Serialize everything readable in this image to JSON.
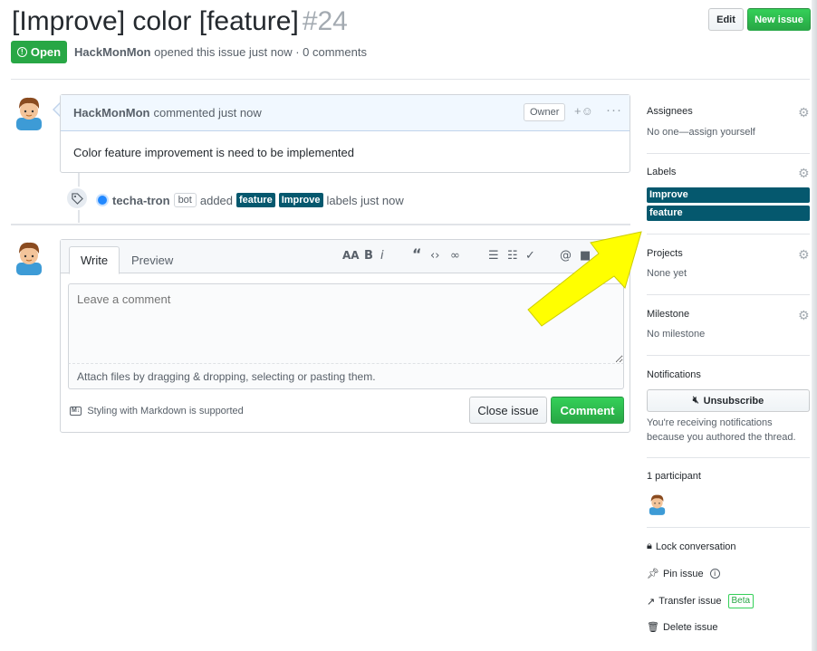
{
  "header": {
    "title": "[Improve] color [feature]",
    "number": "#24",
    "edit_label": "Edit",
    "new_issue_label": "New issue",
    "state_label": "Open",
    "author": "HackMonMon",
    "meta_text": "opened this issue just now · 0 comments"
  },
  "comment": {
    "author": "HackMonMon",
    "action": "commented just now",
    "owner_badge": "Owner",
    "body": "Color feature improvement is need to be implemented"
  },
  "event": {
    "actor": "techa-tron",
    "bot_badge": "bot",
    "verb": "added",
    "labels": [
      "feature",
      "Improve"
    ],
    "suffix": "labels just now"
  },
  "new_comment": {
    "tab_write": "Write",
    "tab_preview": "Preview",
    "placeholder": "Leave a comment",
    "drop_hint": "Attach files by dragging & dropping, selecting or pasting them.",
    "markdown_hint": "Styling with Markdown is supported",
    "close_issue_label": "Close issue",
    "comment_label": "Comment"
  },
  "sidebar": {
    "assignees": {
      "heading": "Assignees",
      "text": "No one—assign yourself"
    },
    "labels": {
      "heading": "Labels",
      "items": [
        "Improve",
        "feature"
      ],
      "color": "#05586e"
    },
    "projects": {
      "heading": "Projects",
      "text": "None yet"
    },
    "milestone": {
      "heading": "Milestone",
      "text": "No milestone"
    },
    "notifications": {
      "heading": "Notifications",
      "button_label": "Unsubscribe",
      "text": "You're receiving notifications because you authored the thread."
    },
    "participants": {
      "heading": "1 participant"
    },
    "actions": {
      "lock": "Lock conversation",
      "pin": "Pin issue",
      "transfer": "Transfer issue",
      "beta": "Beta",
      "delete": "Delete issue"
    }
  },
  "colors": {
    "green": "#28a745",
    "label": "#05586e",
    "annotation": "#ffff00"
  }
}
